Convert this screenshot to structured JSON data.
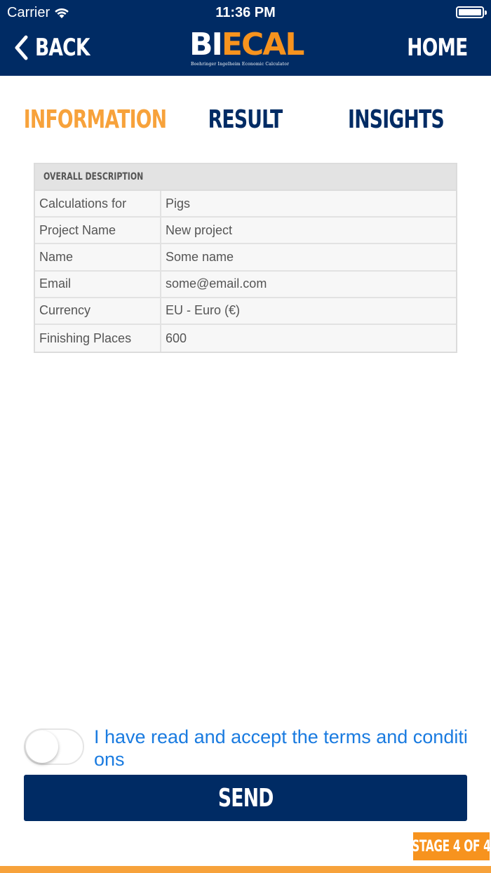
{
  "status_bar": {
    "carrier": "Carrier",
    "time": "11:36 PM"
  },
  "header": {
    "back_label": "BACK",
    "home_label": "HOME",
    "logo": {
      "part_white": "BI",
      "part_orange": "ECAL",
      "tagline": "Boehringer Ingelheim Economic Calculator"
    }
  },
  "tabs": [
    {
      "label": "INFORMATION",
      "active": true
    },
    {
      "label": "RESULT",
      "active": false
    },
    {
      "label": "INSIGHTS",
      "active": false
    }
  ],
  "description_table": {
    "heading": "OVERALL DESCRIPTION",
    "rows": [
      {
        "key": "Calculations for",
        "value": "Pigs"
      },
      {
        "key": "Project Name",
        "value": "New project"
      },
      {
        "key": "Name",
        "value": "Some name"
      },
      {
        "key": "Email",
        "value": "some@email.com"
      },
      {
        "key": "Currency",
        "value": "EU - Euro (€)"
      },
      {
        "key": "Finishing Places",
        "value": "600"
      }
    ]
  },
  "terms": {
    "text": "I have read and accept the terms and conditions",
    "accepted": false
  },
  "send_label": "SEND",
  "stage_label": "STAGE 4 OF 4",
  "colors": {
    "navy": "#002b64",
    "orange": "#f7931e",
    "link_blue": "#1a7be0"
  }
}
